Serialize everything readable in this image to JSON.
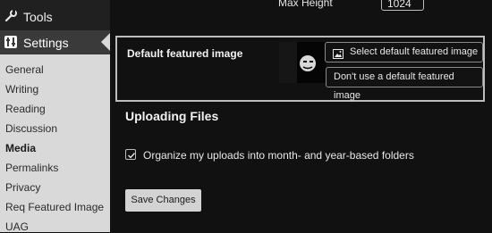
{
  "sidebar": {
    "tools_label": "Tools",
    "settings_label": "Settings",
    "items": [
      {
        "label": "General"
      },
      {
        "label": "Writing"
      },
      {
        "label": "Reading"
      },
      {
        "label": "Discussion"
      },
      {
        "label": "Media"
      },
      {
        "label": "Permalinks"
      },
      {
        "label": "Privacy"
      },
      {
        "label": "Req Featured Image"
      },
      {
        "label": "UAG"
      }
    ],
    "active_item": "Media"
  },
  "main": {
    "max_height_label": "Max Height",
    "max_height_value": "1024",
    "default_featured": {
      "title": "Default featured image",
      "select_button": "Select default featured image",
      "remove_button": "Don't use a default featured image"
    },
    "uploading": {
      "heading": "Uploading Files",
      "organize_label": "Organize my uploads into month- and year-based folders",
      "organize_checked": true
    },
    "save_button": "Save Changes"
  }
}
